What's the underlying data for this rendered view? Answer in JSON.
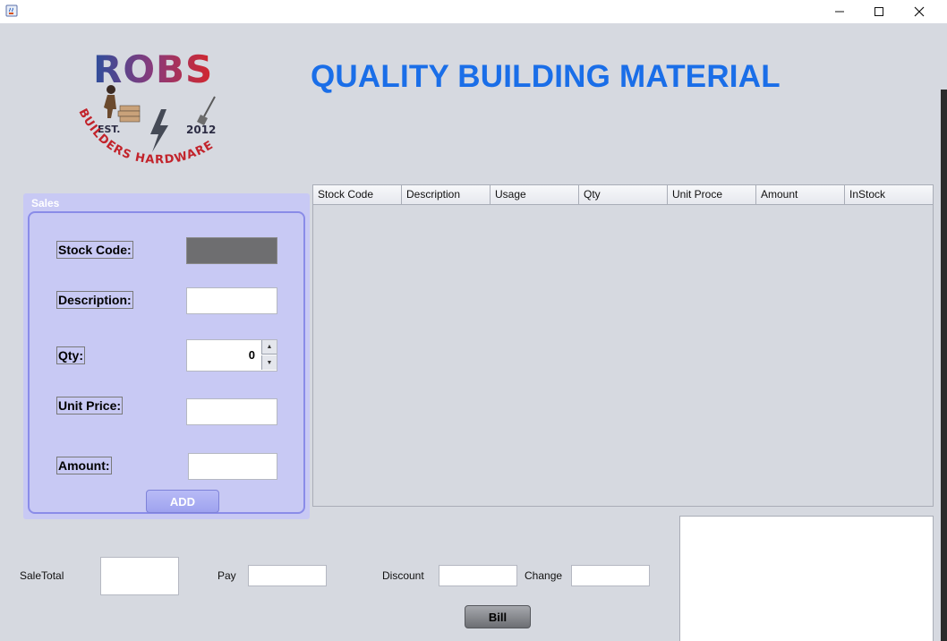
{
  "window": {
    "icon": "java-cup-icon"
  },
  "header": {
    "logo_top": "ROBS",
    "logo_est": "EST.",
    "logo_year": "2012",
    "logo_bottom": "BUILDERS HARDWARE",
    "headline": "QUALITY BUILDING MATERIAL"
  },
  "sales": {
    "title": "Sales",
    "stock_code_label": "Stock Code:",
    "description_label": "Description:",
    "qty_label": "Qty:",
    "qty_value": "0",
    "unit_price_label": "Unit Price:",
    "amount_label": "Amount:",
    "add_label": "ADD"
  },
  "table": {
    "columns": [
      "Stock Code",
      "Description",
      "Usage",
      "Qty",
      "Unit Proce",
      "Amount",
      "InStock"
    ],
    "rows": []
  },
  "footer": {
    "sale_total_label": "SaleTotal",
    "pay_label": "Pay",
    "discount_label": "Discount",
    "change_label": "Change",
    "bill_label": "Bill"
  },
  "colors": {
    "headline": "#1a6ee8",
    "panel": "#c8c9f4",
    "background": "#d6d9e0"
  }
}
